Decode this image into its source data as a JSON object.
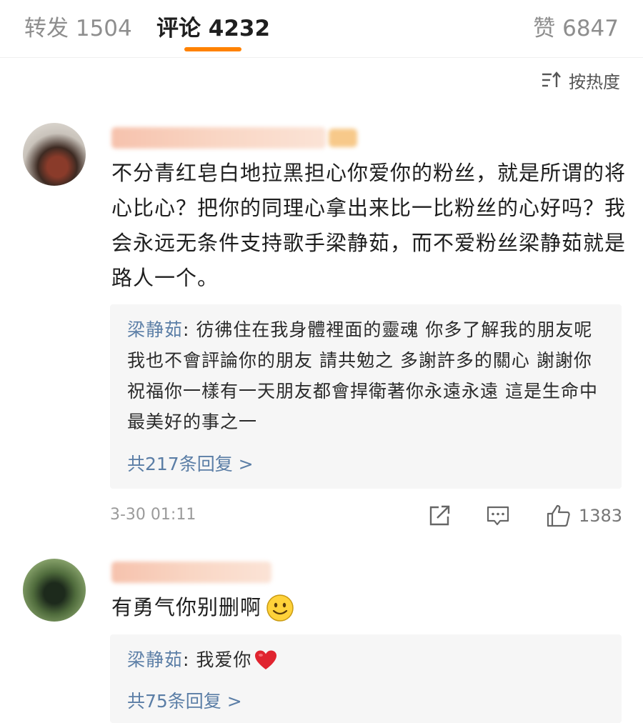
{
  "tabs": {
    "repost": "转发 1504",
    "comments": "评论 4232",
    "likes": "赞 6847"
  },
  "sort": {
    "label": "按热度",
    "icon": "sort-icon"
  },
  "comments": [
    {
      "text": "不分青红皂白地拉黑担心你爱你的粉丝，就是所谓的将心比心？把你的同理心拿出来比一比粉丝的心好吗？我会永远无条件支持歌手梁静茹，而不爱粉丝梁静茹就是路人一个。",
      "reply": {
        "author": "梁静茹",
        "text": ": 彷彿住在我身體裡面的靈魂 你多了解我的朋友呢 我也不會評論你的朋友 請共勉之  多謝許多的關心 謝謝你祝福你一樣有一天朋友都會捍衛著你永遠永遠 這是生命中最美好的事之一",
        "count": "共217条回复 >"
      },
      "timestamp": "3-30 01:11",
      "likes": "1383"
    },
    {
      "text": "有勇气你别删啊",
      "emoji": "smile-emoji",
      "reply": {
        "author": "梁静茹",
        "text": ": 我爱你",
        "emoji": "heart-emoji",
        "count": "共75条回复 >"
      }
    }
  ],
  "colors": {
    "accent": "#ff8200",
    "link": "#5b7ea6"
  }
}
